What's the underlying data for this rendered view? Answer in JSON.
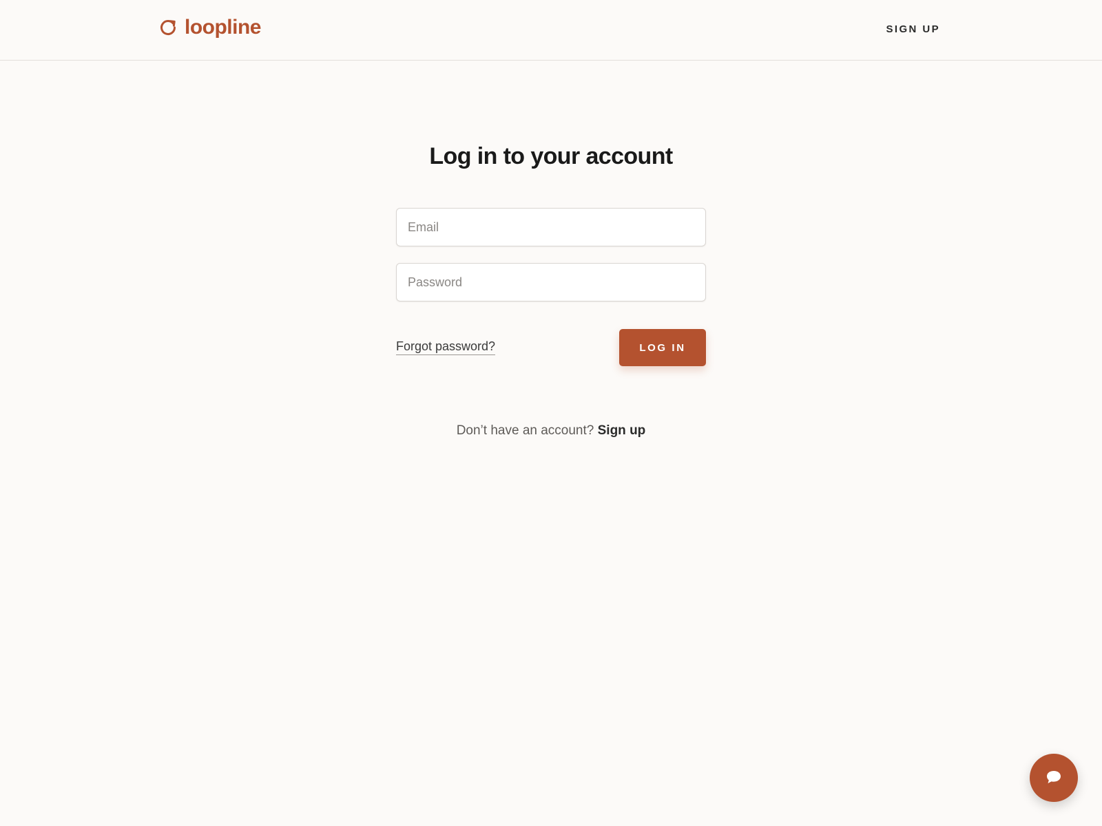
{
  "header": {
    "brand_name": "loopline",
    "brand_icon": "refresh-loop-icon",
    "signup_label": "SIGN UP"
  },
  "login": {
    "title": "Log in to your account",
    "email_placeholder": "Email",
    "email_value": "",
    "password_placeholder": "Password",
    "password_value": "",
    "forgot_label": "Forgot password?",
    "submit_label": "LOG IN"
  },
  "footer_prompt": {
    "text": "Don’t have an account?",
    "link_label": "Sign up"
  },
  "chat": {
    "icon": "chat-bubble-icon"
  },
  "colors": {
    "accent": "#b4522f",
    "background": "#fcfaf8",
    "text": "#1a1a1a"
  }
}
